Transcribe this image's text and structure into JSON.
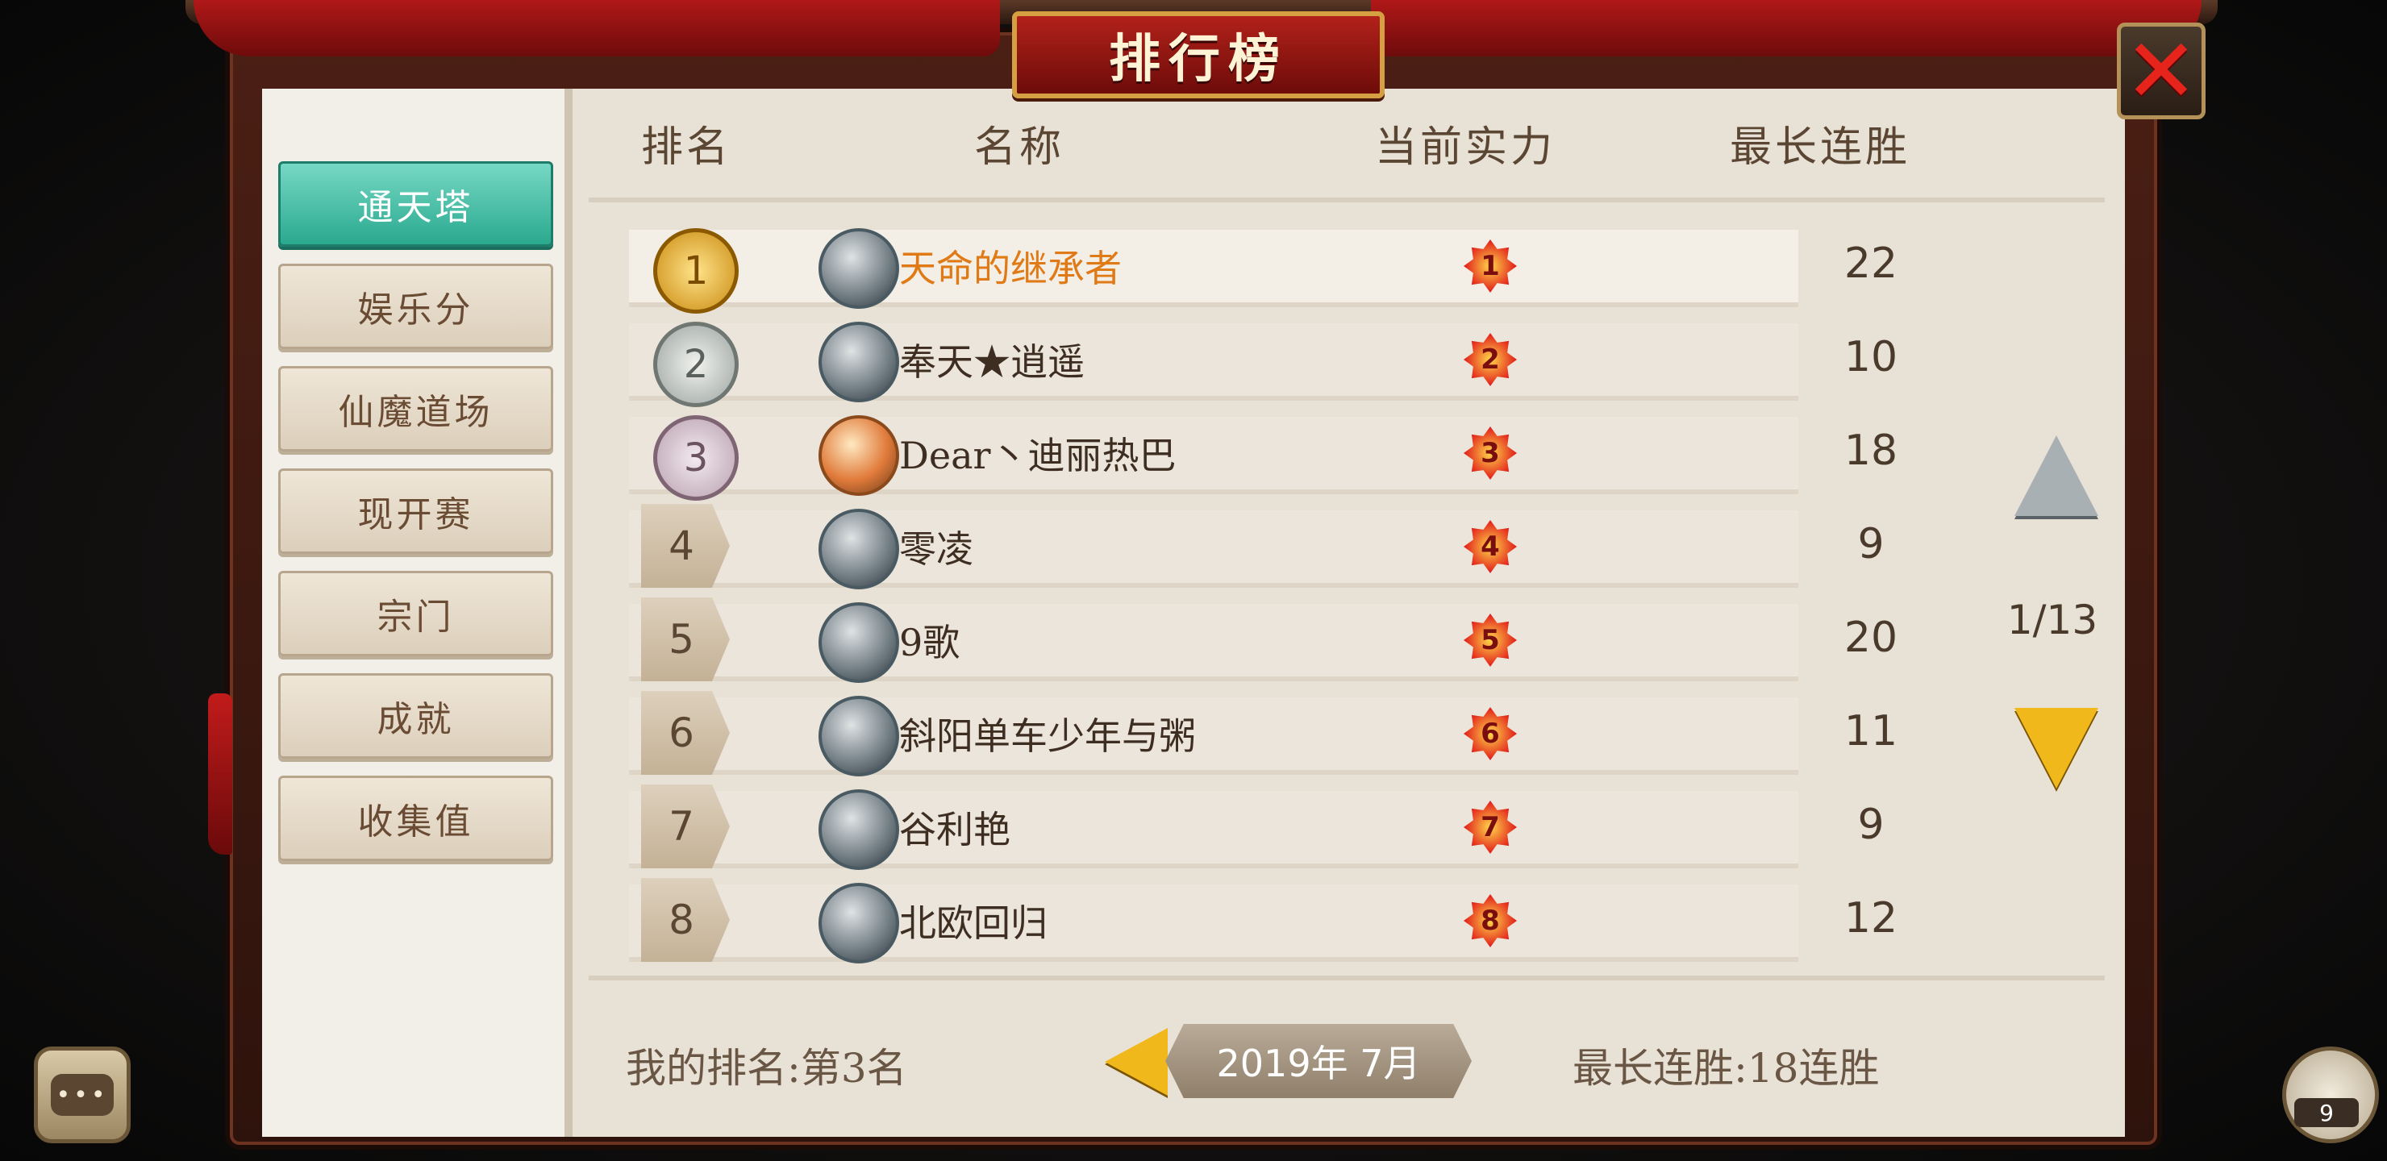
{
  "title": "排行榜",
  "close_icon": "close-icon",
  "tabs": [
    {
      "label": "通天塔",
      "active": true
    },
    {
      "label": "娱乐分",
      "active": false
    },
    {
      "label": "仙魔道场",
      "active": false
    },
    {
      "label": "现开赛",
      "active": false
    },
    {
      "label": "宗门",
      "active": false
    },
    {
      "label": "成就",
      "active": false
    },
    {
      "label": "收集值",
      "active": false
    }
  ],
  "columns": {
    "rank": "排名",
    "name": "名称",
    "power": "当前实力",
    "streak": "最长连胜"
  },
  "rows": [
    {
      "rank": "1",
      "name": "天命的继承者",
      "power": "1",
      "streak": "22"
    },
    {
      "rank": "2",
      "name": "奉天★逍遥",
      "power": "2",
      "streak": "10"
    },
    {
      "rank": "3",
      "name": "Dear丶迪丽热巴",
      "power": "3",
      "streak": "18"
    },
    {
      "rank": "4",
      "name": "零凌",
      "power": "4",
      "streak": "9"
    },
    {
      "rank": "5",
      "name": "9歌",
      "power": "5",
      "streak": "20"
    },
    {
      "rank": "6",
      "name": "斜阳单车少年与粥",
      "power": "6",
      "streak": "11"
    },
    {
      "rank": "7",
      "name": "谷利艳",
      "power": "7",
      "streak": "9"
    },
    {
      "rank": "8",
      "name": "北欧回归",
      "power": "8",
      "streak": "12"
    }
  ],
  "pagination": {
    "page_indicator": "1/13"
  },
  "footer": {
    "my_rank": "我的排名:第3名",
    "date": "2019年 7月",
    "best_streak": "最长连胜:18连胜"
  },
  "friends": {
    "count": "9"
  },
  "colors": {
    "active_tab": "#2aa98f",
    "first_name": "#e07a16",
    "scroll_down": "#f0b81a",
    "scroll_up": "#a9b0b4",
    "close": "#e6241b"
  }
}
